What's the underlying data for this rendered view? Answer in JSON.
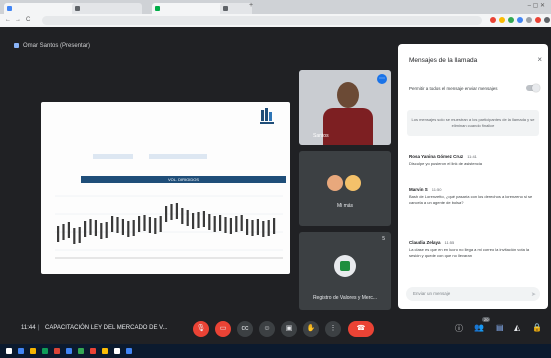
{
  "browser": {
    "tabs": [
      {
        "label": "",
        "color": "#4285f4"
      },
      {
        "label": "",
        "color": "#5f6368"
      },
      {
        "label": "",
        "color": "#00ac47"
      },
      {
        "label": "",
        "color": "#5f6368"
      }
    ],
    "nav": {
      "back": "←",
      "forward": "→",
      "reload": "C"
    },
    "url": "",
    "extension_colors": [
      "#ea4335",
      "#fbbc04",
      "#34a853",
      "#4285f4",
      "#9aa0a6",
      "#ea4335",
      "#5f6368"
    ]
  },
  "meeting": {
    "presenter_label": "Omar Santos (Presentar)",
    "slide": {
      "header_right": "",
      "title_lines": [
        "",
        "",
        "",
        ""
      ],
      "banner": "VOL. DIRIGIDOS"
    },
    "tiles": [
      {
        "name": "Santos",
        "icon": "mic-active-icon"
      },
      {
        "name": "Mi más",
        "icon": "avatar-group"
      },
      {
        "name": "Registro de Valores y Merc...",
        "badge": "5"
      }
    ]
  },
  "chat": {
    "title": "Mensajes de la llamada",
    "close": "×",
    "option_label": "Permitir a todos el mensaje enviar mensajes",
    "notice": "Los mensajes solo se muestran a los participantes de la llamada y se eliminan cuando finalice",
    "messages": [
      {
        "author": "Rosa Yanina Gómez Cruz",
        "time": "11:41",
        "text": "Disculpe yo pusieron el link de asistencia"
      },
      {
        "author": "Marvin S",
        "time": "11:50",
        "text": "Bash de Lorenzetto, ¿qué pasaría con los derechos a lorenzeno si se cancela a un agente de bolsa?"
      },
      {
        "author": "Claudia Zelaya",
        "time": "11:55",
        "text": "La clase es que en en lucro no llega a mi correo la invitación vota la sesión y quede con que no llevaran"
      }
    ],
    "input_placeholder": "Enviar un mensaje",
    "send_icon": "send-icon"
  },
  "controls": {
    "time": "11:44",
    "meeting_title": "CAPACITACIÓN LEY DEL MERCADO DE V...",
    "buttons": [
      "mic-off-icon",
      "camera-off-icon",
      "captions-icon",
      "emoji-icon",
      "present-icon",
      "raise-hand-icon",
      "more-icon"
    ],
    "end_call": "☎",
    "right_icons": [
      "info-icon",
      "people-icon",
      "chat-icon",
      "activities-icon",
      "lock-icon"
    ],
    "people_badge": "20"
  },
  "taskbar": {
    "icon_colors": [
      "#ffffff",
      "#4285f4",
      "#f4b400",
      "#0f9d58",
      "#db4437",
      "#4285f4",
      "#34a853",
      "#ea4335",
      "#fbbc04",
      "#ffffff",
      "#4285f4"
    ],
    "clock": ""
  }
}
